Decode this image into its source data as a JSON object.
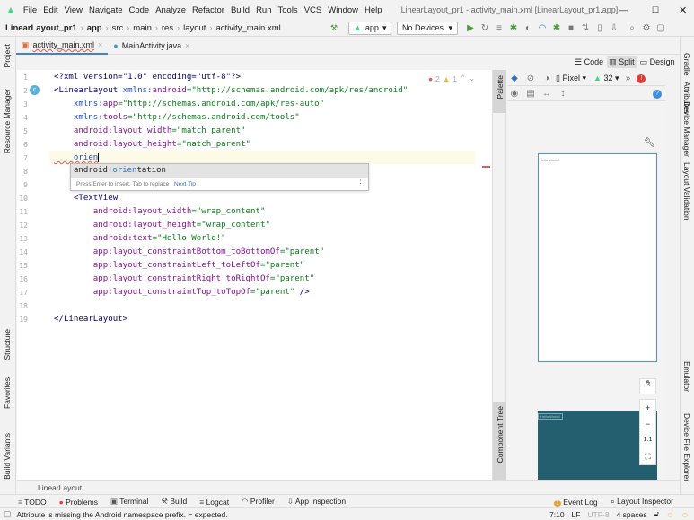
{
  "menu": [
    "File",
    "Edit",
    "View",
    "Navigate",
    "Code",
    "Analyze",
    "Refactor",
    "Build",
    "Run",
    "Tools",
    "VCS",
    "Window",
    "Help"
  ],
  "window_title": "LinearLayout_pr1 - activity_main.xml [LinearLayout_pr1.app]",
  "breadcrumbs": [
    "LinearLayout_pr1",
    "app",
    "src",
    "main",
    "res",
    "layout",
    "activity_main.xml"
  ],
  "run_config": "app",
  "device": "No Devices",
  "tabs": [
    "activity_main.xml",
    "MainActivity.java"
  ],
  "view_modes": {
    "code": "Code",
    "split": "Split",
    "design": "Design"
  },
  "left_tools": [
    "Project",
    "Resource Manager",
    "Structure",
    "Favorites",
    "Build Variants"
  ],
  "right_tools": [
    "Gradle",
    "Attributes",
    "Device Manager",
    "Layout Validation",
    "Emulator",
    "Device File Explorer"
  ],
  "inspection": {
    "errors": "2",
    "warnings": "1"
  },
  "lines": [
    [
      [
        "<?xml version=\"1.0\" encoding=\"utf-8\"?>",
        "t"
      ]
    ],
    [
      [
        "<LinearLayout ",
        "t"
      ],
      [
        "xmlns:",
        "n"
      ],
      [
        "android",
        "a"
      ],
      [
        "=\"http://schemas.android.com/apk/res/android\"",
        "s"
      ]
    ],
    [
      [
        "    xmlns:",
        "n"
      ],
      [
        "app",
        "a"
      ],
      [
        "=\"http://schemas.android.com/apk/res-auto\"",
        "s"
      ]
    ],
    [
      [
        "    xmlns:",
        "n"
      ],
      [
        "tools",
        "a"
      ],
      [
        "=\"http://schemas.android.com/tools\"",
        "s"
      ]
    ],
    [
      [
        "    android:",
        "a"
      ],
      [
        "layout_width",
        "a"
      ],
      [
        "=\"match_parent\"",
        "s"
      ]
    ],
    [
      [
        "    android:",
        "a"
      ],
      [
        "layout_height",
        "a"
      ],
      [
        "=\"match_parent\"",
        "s"
      ]
    ],
    [
      [
        "    orien",
        "n"
      ]
    ],
    [],
    [],
    [
      [
        "    <TextView",
        "t"
      ]
    ],
    [
      [
        "        android:layout_width",
        "a"
      ],
      [
        "=\"wrap_content\"",
        "s"
      ]
    ],
    [
      [
        "        android:layout_height",
        "a"
      ],
      [
        "=\"wrap_content\"",
        "s"
      ]
    ],
    [
      [
        "        android:text",
        "a"
      ],
      [
        "=\"Hello World!\"",
        "s"
      ]
    ],
    [
      [
        "        app:layout_constraintBottom_toBottomOf",
        "a"
      ],
      [
        "=\"parent\"",
        "s"
      ]
    ],
    [
      [
        "        app:layout_constraintLeft_toLeftOf",
        "a"
      ],
      [
        "=\"parent\"",
        "s"
      ]
    ],
    [
      [
        "        app:layout_constraintRight_toRightOf",
        "a"
      ],
      [
        "=\"parent\"",
        "s"
      ]
    ],
    [
      [
        "        app:layout_constraintTop_toTopOf",
        "a"
      ],
      [
        "=\"parent\"",
        "s"
      ],
      [
        " />",
        "t"
      ]
    ],
    [],
    [
      [
        "</LinearLayout>",
        "t"
      ]
    ]
  ],
  "completion": {
    "prefix": "android:",
    "match": "orien",
    "rest": "tation",
    "hint": "Press Enter to insert, Tab to replace",
    "next_tip": "Next Tip"
  },
  "preview": {
    "palette": "Palette",
    "component_tree": "Component Tree",
    "device": "Pixel",
    "api": "32",
    "hello": "Hello World!",
    "zoom_reset": "1:1"
  },
  "element_breadcrumb": "LinearLayout",
  "bottom_tools": [
    "TODO",
    "Problems",
    "Terminal",
    "Build",
    "Logcat",
    "Profiler",
    "App Inspection"
  ],
  "bottom_right": {
    "event_log": "Event Log",
    "event_count": "1",
    "layout_inspector": "Layout Inspector"
  },
  "status": {
    "message": "Attribute is missing the Android namespace prefix. = expected.",
    "position": "7:10",
    "line_sep": "LF",
    "encoding": "UTF-8",
    "indent": "4 spaces"
  }
}
